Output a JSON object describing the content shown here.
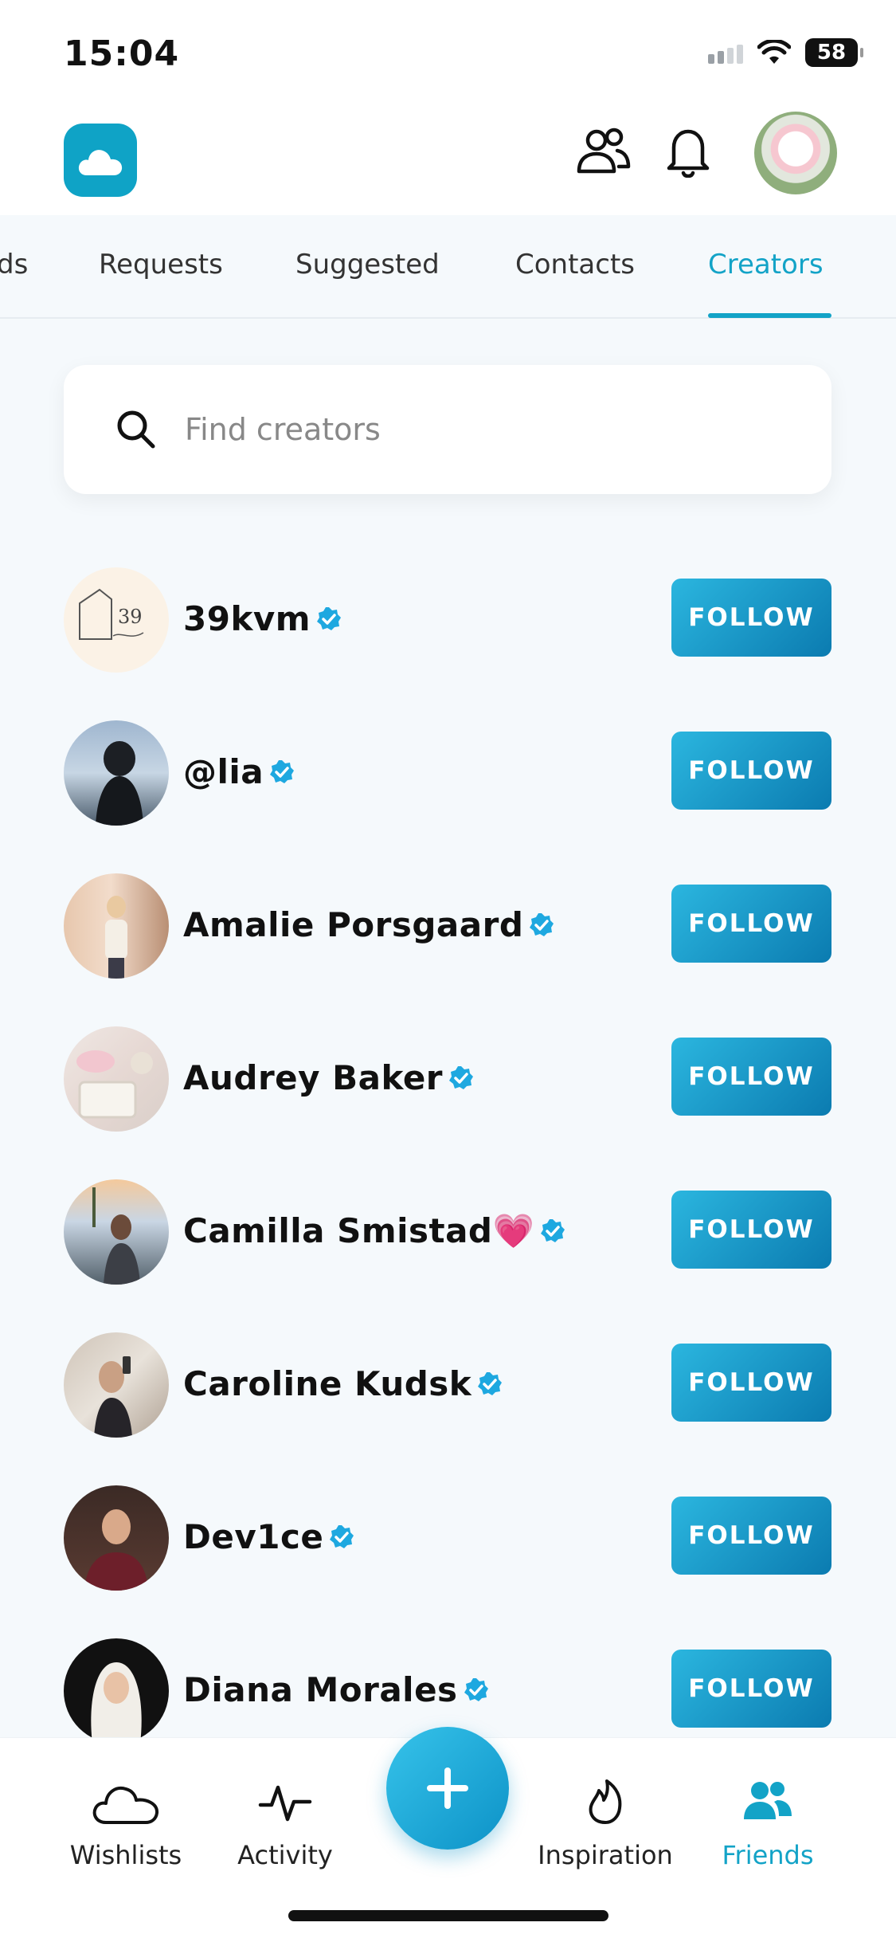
{
  "status_bar": {
    "time": "15:04",
    "battery": "58"
  },
  "tabs": [
    {
      "label": "ds"
    },
    {
      "label": "Requests"
    },
    {
      "label": "Suggested"
    },
    {
      "label": "Contacts"
    },
    {
      "label": "Creators",
      "active": true
    }
  ],
  "search": {
    "placeholder": "Find creators",
    "value": ""
  },
  "creators": [
    {
      "name": "39kvm",
      "follow_label": "FOLLOW"
    },
    {
      "name": "@lia",
      "follow_label": "FOLLOW"
    },
    {
      "name": "Amalie Porsgaard",
      "follow_label": "FOLLOW"
    },
    {
      "name": "Audrey Baker",
      "follow_label": "FOLLOW"
    },
    {
      "name": "Camilla Smistad💗",
      "follow_label": "FOLLOW"
    },
    {
      "name": "Caroline Kudsk",
      "follow_label": "FOLLOW"
    },
    {
      "name": "Dev1ce",
      "follow_label": "FOLLOW"
    },
    {
      "name": "Diana Morales",
      "follow_label": "FOLLOW"
    }
  ],
  "bottom_nav": {
    "wishlists": "Wishlists",
    "activity": "Activity",
    "inspiration": "Inspiration",
    "friends": "Friends"
  },
  "colors": {
    "accent": "#13a3c7",
    "logo": "#0fa3c6",
    "button_start": "#2bb6df",
    "button_end": "#0b7bb0"
  },
  "icons": [
    "cloud-logo-icon",
    "friends-icon",
    "bell-icon",
    "search-icon",
    "verified-icon",
    "plus-icon",
    "wishlist-cloud-icon",
    "activity-icon",
    "flame-icon",
    "friends-nav-icon"
  ]
}
